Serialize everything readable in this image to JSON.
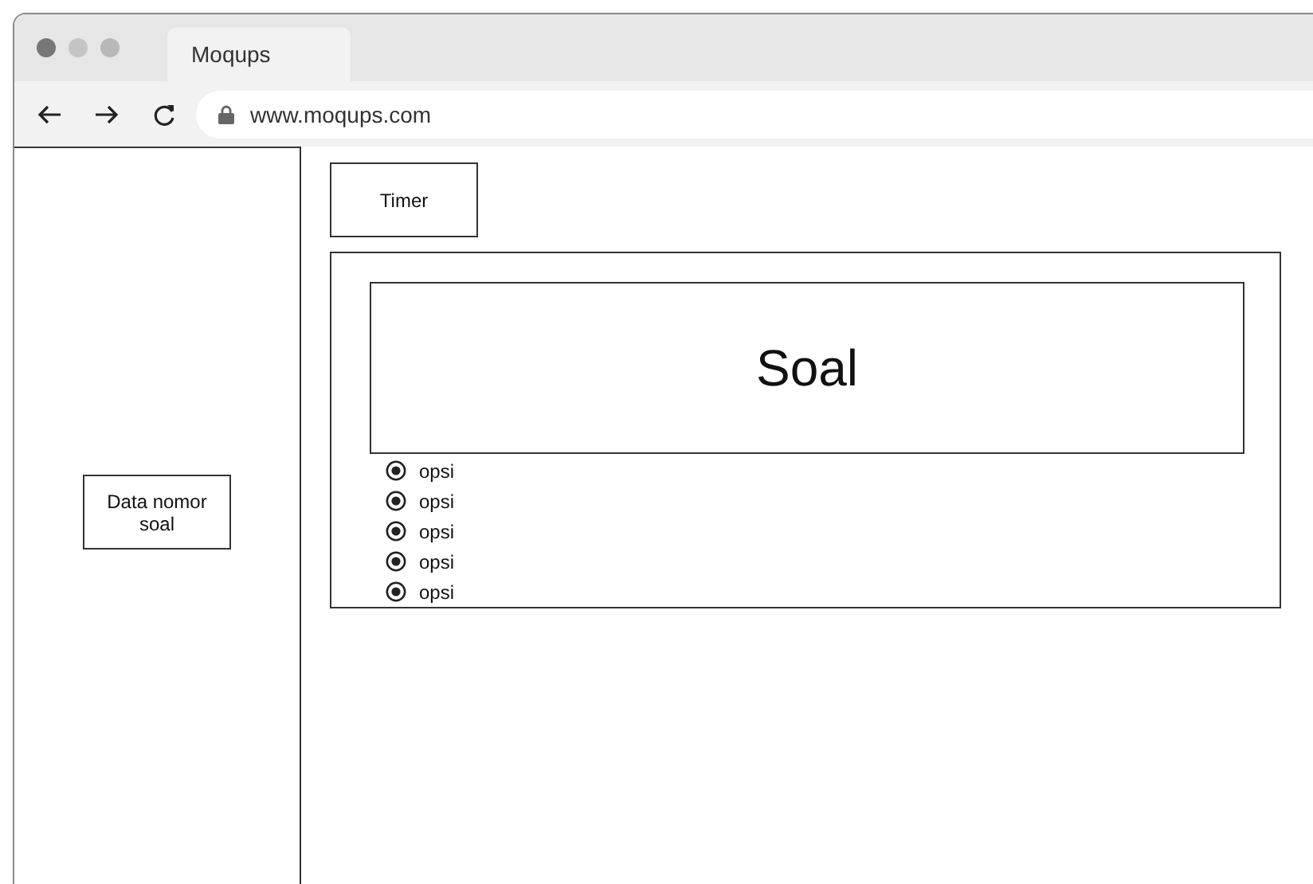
{
  "browser": {
    "tab_title": "Moqups",
    "url": "www.moqups.com"
  },
  "sidebar": {
    "label": "Data nomor soal"
  },
  "timer": {
    "label": "Timer"
  },
  "question": {
    "text": "Soal",
    "options": [
      {
        "label": "opsi",
        "selected": true
      },
      {
        "label": "opsi",
        "selected": true
      },
      {
        "label": "opsi",
        "selected": true
      },
      {
        "label": "opsi",
        "selected": true
      },
      {
        "label": "opsi",
        "selected": true
      }
    ]
  }
}
